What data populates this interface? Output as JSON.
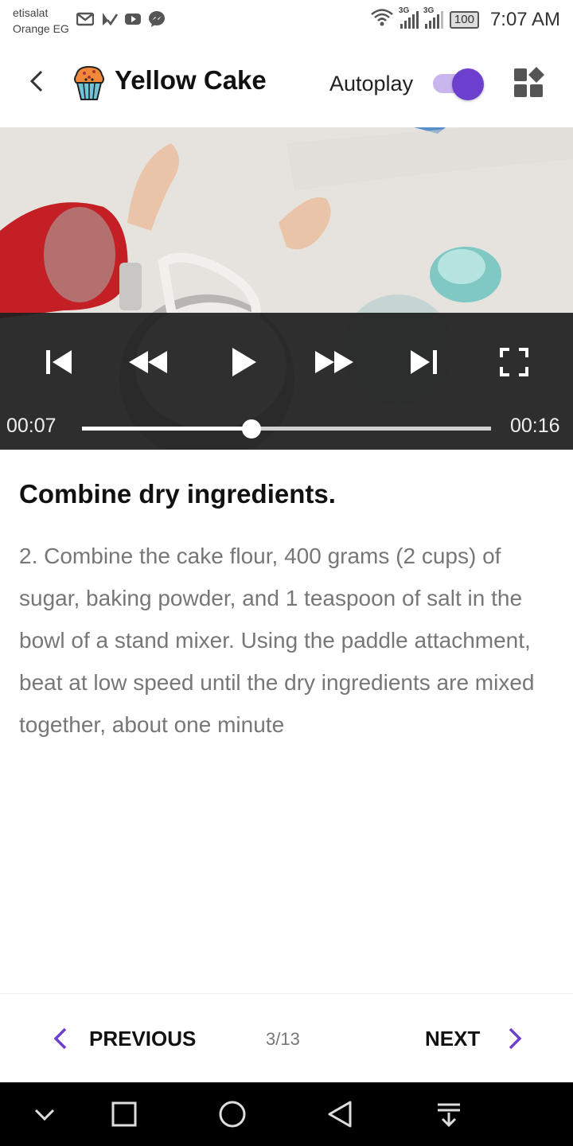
{
  "status_bar": {
    "carrier_line1": "etisalat",
    "carrier_line2": "Orange EG",
    "notification_icons": [
      "gmail-icon",
      "check-app-icon",
      "youtube-icon",
      "messenger-icon"
    ],
    "network_1": "3G",
    "network_2": "3G",
    "battery": "100",
    "time": "7:07 AM"
  },
  "app_bar": {
    "title": "Yellow Cake",
    "autoplay_label": "Autoplay",
    "autoplay_on": true,
    "accent_color": "#6d3fce"
  },
  "video": {
    "current_time": "00:07",
    "duration": "00:16",
    "progress": 0.415
  },
  "step": {
    "title": "Combine dry ingredients.",
    "text": "2. Combine the cake flour, 400 grams (2 cups) of sugar, baking powder, and 1 teaspoon of salt in the bowl of a stand mixer. Using the paddle attachment, beat at low speed until the dry ingredients are mixed together, about one minute"
  },
  "bottom_nav": {
    "previous_label": "PREVIOUS",
    "next_label": "NEXT",
    "page_indicator": "3/13"
  }
}
